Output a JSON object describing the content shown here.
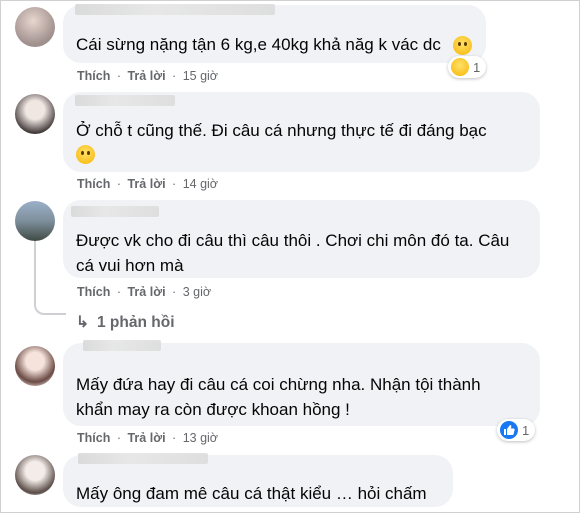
{
  "actions": {
    "like": "Thích",
    "reply": "Trả lời",
    "sep": "·"
  },
  "comments": [
    {
      "text": "Cái sừng nặng tận 6 kg,e 40kg khả năg k vác dc",
      "time": "15 giờ",
      "reactions": "1",
      "reaction_icon": "haha-icon",
      "emoji_icon": "smile-emoji-icon"
    },
    {
      "text": "Ở chỗ t cũng thế. Đi câu cá nhưng thực tế đi đáng bạc",
      "time": "14 giờ",
      "emoji_icon": "smile-emoji-icon"
    },
    {
      "text": "Được vk cho đi câu thì câu thôi . Chơi chi môn đó ta. Câu\ncá vui hơn mà",
      "time": "3 giờ",
      "replies": "1 phản hồi"
    },
    {
      "text": "Mấy đứa hay đi câu cá coi chừng nha. Nhận tội thành\nkhẩn may ra còn được khoan hồng !",
      "time": "13 giờ",
      "reactions": "1",
      "reaction_icon": "like-icon"
    },
    {
      "text": "Mấy ông đam mê câu cá thật kiểu … hỏi chấm"
    }
  ],
  "colors": {
    "bubble": "#f0f2f5",
    "meta": "#65676b",
    "like_blue": "#1877f2"
  }
}
